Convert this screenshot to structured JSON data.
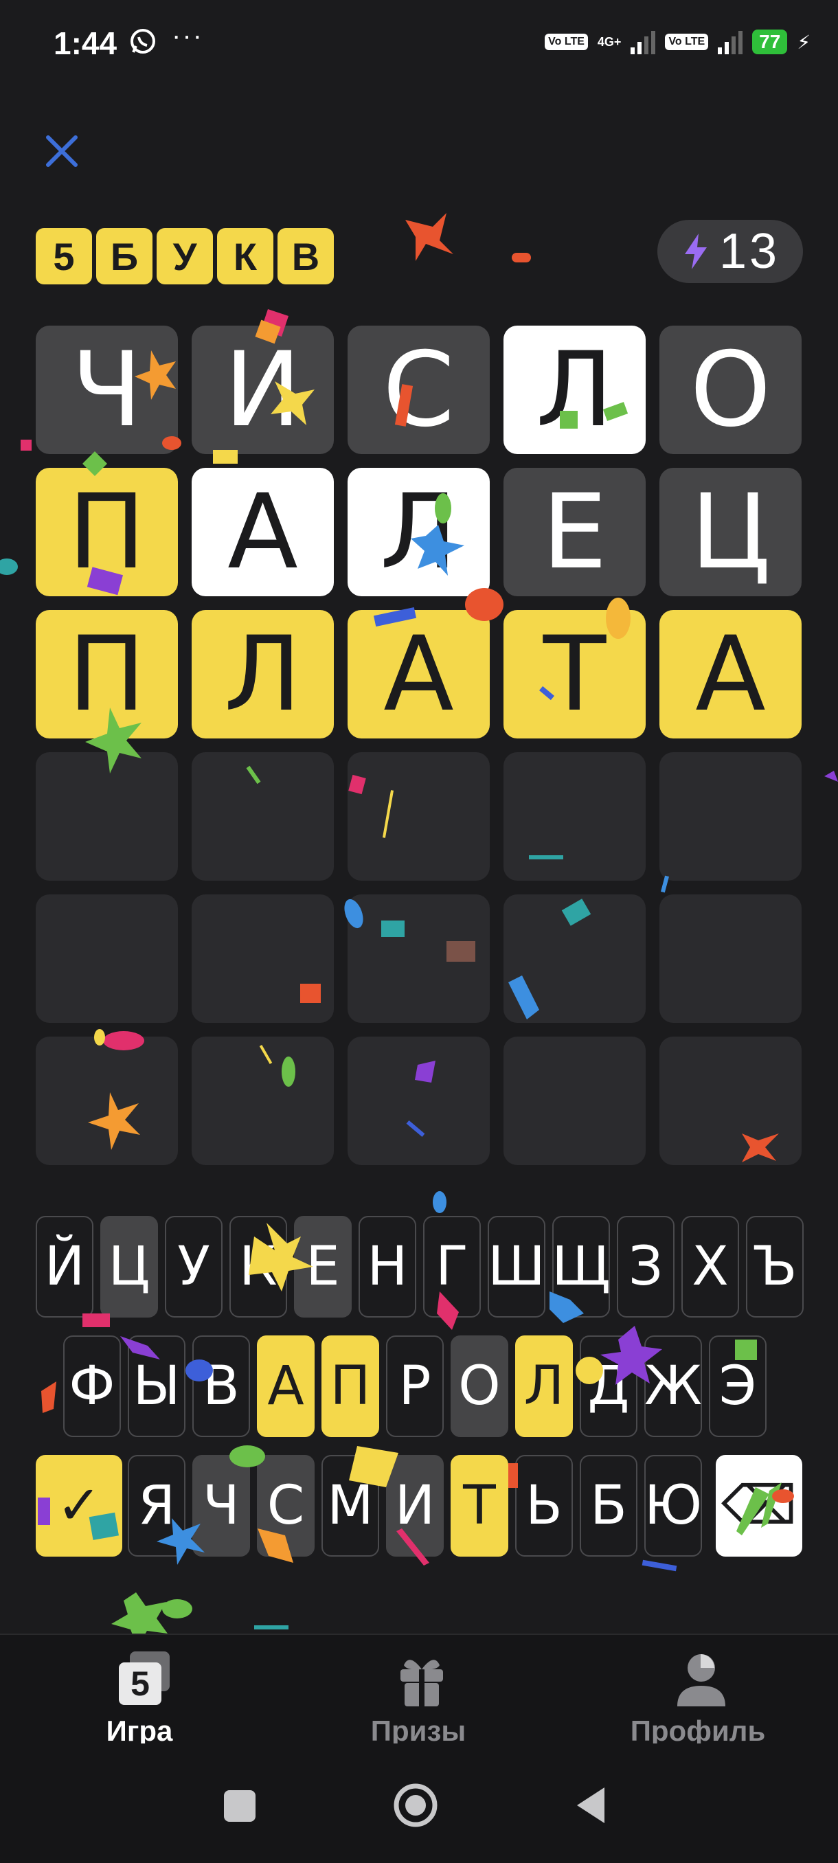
{
  "status_bar": {
    "time": "1:44",
    "dots": "···",
    "volte1": "Vo LTE",
    "network": "4G+",
    "volte2": "Vo LTE",
    "battery": "77",
    "icons": [
      "whatsapp-icon",
      "signal-icon",
      "charging-bolt-icon"
    ]
  },
  "header": {
    "close_icon": "close-icon",
    "title_letters": [
      "5",
      "Б",
      "У",
      "К",
      "В"
    ],
    "energy_count": "13",
    "energy_icon": "lightning-icon"
  },
  "colors": {
    "background": "#1b1b1d",
    "present": "#f4d84b",
    "absent": "#454547",
    "correct": "#ffffff",
    "empty": "#2b2b2e",
    "accent_close": "#3d6fd9",
    "energy_bolt": "#9a6cf2"
  },
  "board": {
    "rows": [
      [
        {
          "l": "Ч",
          "s": "gray"
        },
        {
          "l": "И",
          "s": "gray"
        },
        {
          "l": "С",
          "s": "gray"
        },
        {
          "l": "Л",
          "s": "white"
        },
        {
          "l": "О",
          "s": "gray"
        }
      ],
      [
        {
          "l": "П",
          "s": "yellow"
        },
        {
          "l": "А",
          "s": "white"
        },
        {
          "l": "Л",
          "s": "white"
        },
        {
          "l": "Е",
          "s": "gray"
        },
        {
          "l": "Ц",
          "s": "gray"
        }
      ],
      [
        {
          "l": "П",
          "s": "yellow"
        },
        {
          "l": "Л",
          "s": "yellow"
        },
        {
          "l": "А",
          "s": "yellow"
        },
        {
          "l": "Т",
          "s": "yellow"
        },
        {
          "l": "А",
          "s": "yellow"
        }
      ],
      [
        {
          "l": "",
          "s": "empty"
        },
        {
          "l": "",
          "s": "empty"
        },
        {
          "l": "",
          "s": "empty"
        },
        {
          "l": "",
          "s": "empty"
        },
        {
          "l": "",
          "s": "empty"
        }
      ],
      [
        {
          "l": "",
          "s": "empty"
        },
        {
          "l": "",
          "s": "empty"
        },
        {
          "l": "",
          "s": "empty"
        },
        {
          "l": "",
          "s": "empty"
        },
        {
          "l": "",
          "s": "empty"
        }
      ],
      [
        {
          "l": "",
          "s": "empty"
        },
        {
          "l": "",
          "s": "empty"
        },
        {
          "l": "",
          "s": "empty"
        },
        {
          "l": "",
          "s": "empty"
        },
        {
          "l": "",
          "s": "empty"
        }
      ]
    ]
  },
  "keyboard": {
    "row1": [
      {
        "k": "Й",
        "s": "default"
      },
      {
        "k": "Ц",
        "s": "gray"
      },
      {
        "k": "У",
        "s": "default"
      },
      {
        "k": "К",
        "s": "default"
      },
      {
        "k": "Е",
        "s": "gray"
      },
      {
        "k": "Н",
        "s": "default"
      },
      {
        "k": "Г",
        "s": "default"
      },
      {
        "k": "Ш",
        "s": "default"
      },
      {
        "k": "Щ",
        "s": "default"
      },
      {
        "k": "З",
        "s": "default"
      },
      {
        "k": "Х",
        "s": "default"
      },
      {
        "k": "Ъ",
        "s": "default"
      }
    ],
    "row2": [
      {
        "k": "Ф",
        "s": "default"
      },
      {
        "k": "Ы",
        "s": "default"
      },
      {
        "k": "В",
        "s": "default"
      },
      {
        "k": "А",
        "s": "yellow"
      },
      {
        "k": "П",
        "s": "yellow"
      },
      {
        "k": "Р",
        "s": "default"
      },
      {
        "k": "О",
        "s": "gray"
      },
      {
        "k": "Л",
        "s": "yellow"
      },
      {
        "k": "Д",
        "s": "default"
      },
      {
        "k": "Ж",
        "s": "default"
      },
      {
        "k": "Э",
        "s": "default"
      }
    ],
    "row3": [
      {
        "k": "✓",
        "s": "yellow",
        "name": "submit-key"
      },
      {
        "k": "Я",
        "s": "default"
      },
      {
        "k": "Ч",
        "s": "gray"
      },
      {
        "k": "С",
        "s": "gray"
      },
      {
        "k": "М",
        "s": "default"
      },
      {
        "k": "И",
        "s": "gray"
      },
      {
        "k": "Т",
        "s": "yellow"
      },
      {
        "k": "Ь",
        "s": "default"
      },
      {
        "k": "Б",
        "s": "default"
      },
      {
        "k": "Ю",
        "s": "default"
      },
      {
        "k": "⌫",
        "s": "white",
        "name": "backspace-key"
      }
    ]
  },
  "bottom_nav": {
    "game_label": "Игра",
    "prizes_label": "Призы",
    "profile_label": "Профиль",
    "icons": [
      "game-5-icon",
      "gift-icon",
      "profile-icon"
    ]
  },
  "system_nav": {
    "icons": [
      "recents-square-icon",
      "home-circle-icon",
      "back-triangle-icon"
    ]
  }
}
